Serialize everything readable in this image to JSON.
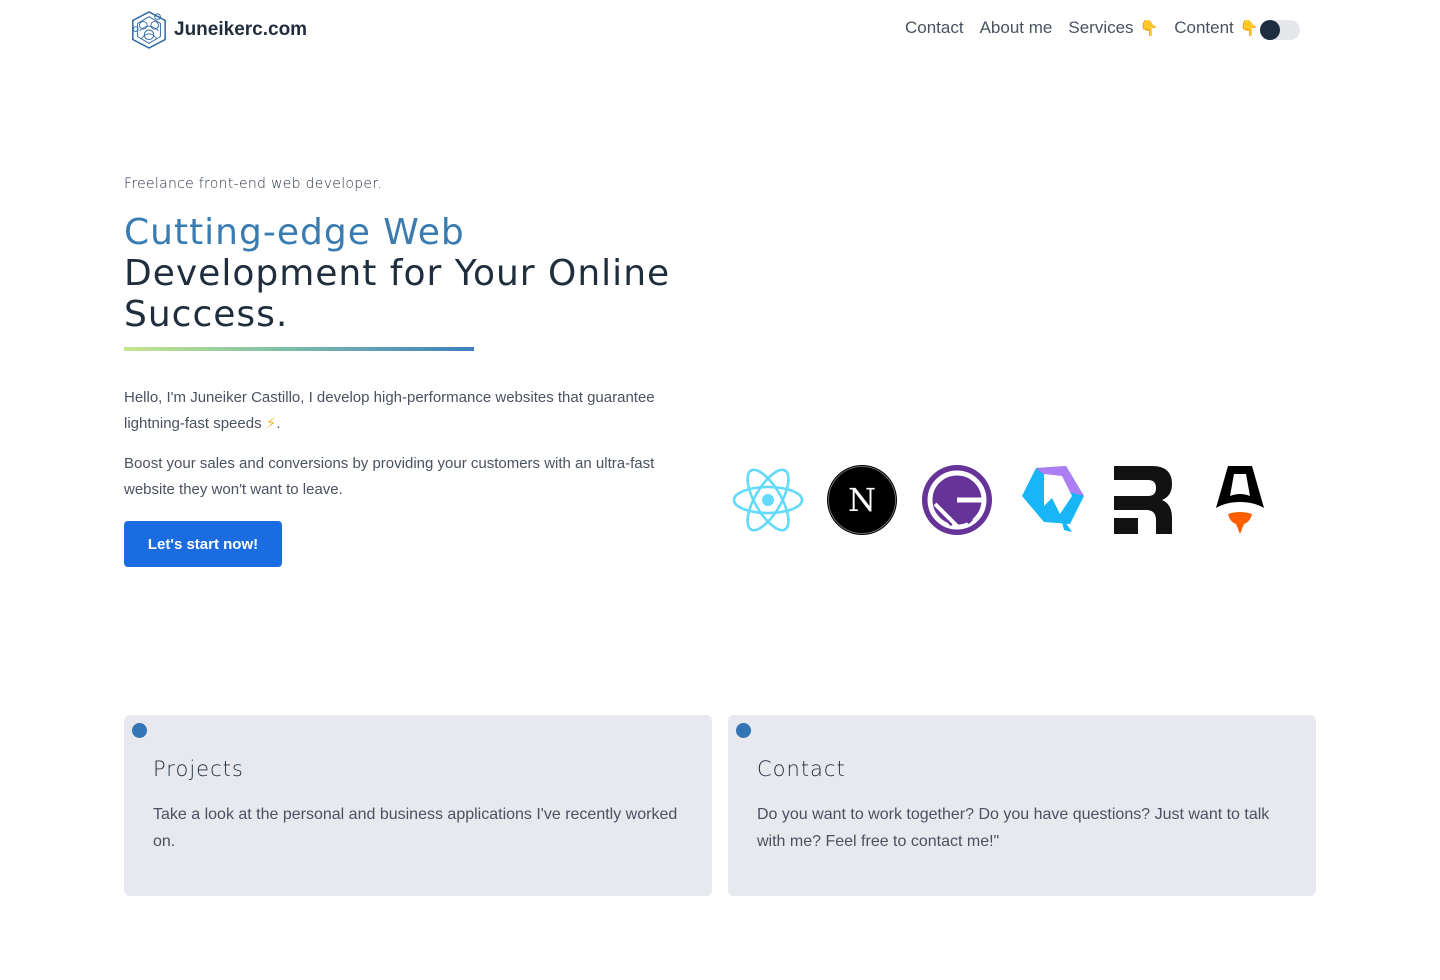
{
  "header": {
    "site_name": "Juneikerc.com",
    "nav": [
      {
        "label": "Contact"
      },
      {
        "label": "About me"
      },
      {
        "label": "Services",
        "emoji": "👇"
      },
      {
        "label": "Content",
        "emoji": "👇"
      }
    ],
    "theme_toggle": "dark-mode-toggle"
  },
  "hero": {
    "eyebrow": "Freelance front-end web developer.",
    "title_accent": "Cutting-edge Web",
    "title_rest": "Development for Your Online Success.",
    "paragraph1_text": "Hello, I'm Juneiker Castillo, I develop high-performance websites that guarantee lightning-fast speeds",
    "paragraph1_emoji": "⚡",
    "paragraph1_end": ".",
    "paragraph2": "Boost your sales and conversions by providing your customers with an ultra-fast website they won't want to leave.",
    "cta_label": "Let's start now!"
  },
  "tech_logos": [
    {
      "icon": "react-icon"
    },
    {
      "icon": "nextjs-icon",
      "letter": "N"
    },
    {
      "icon": "gatsby-icon"
    },
    {
      "icon": "qwik-icon"
    },
    {
      "icon": "remix-icon"
    },
    {
      "icon": "astro-icon"
    }
  ],
  "cards": [
    {
      "title": "Projects",
      "text": "Take a look at the personal and business applications I've recently worked on."
    },
    {
      "title": "Contact",
      "text": "Do you want to work together? Do you have questions? Just want to talk with me? Feel free to contact me!\""
    }
  ],
  "colors": {
    "accent": "#3a7bb0",
    "cta": "#1a6ce0",
    "card_bg": "#e8e9ee",
    "dot": "#3475b5"
  }
}
